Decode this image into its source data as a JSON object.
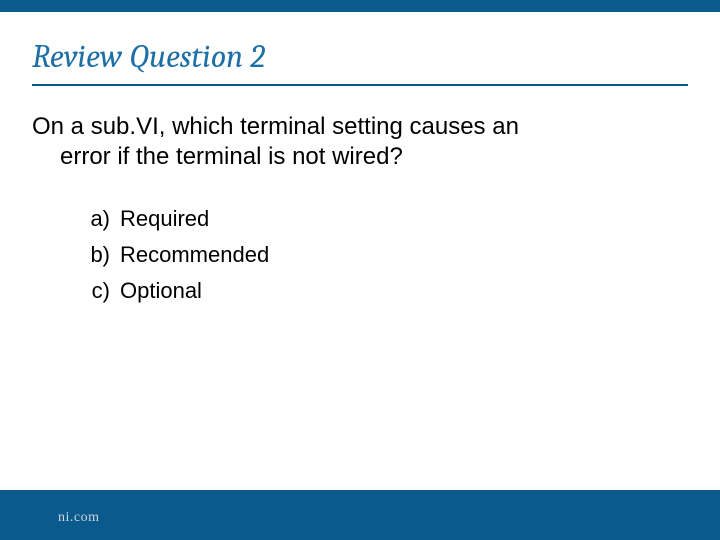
{
  "slide": {
    "title": "Review Question 2",
    "question_line1": "On a sub.VI, which terminal setting causes an",
    "question_line2": "error if the terminal is not wired?",
    "options": [
      {
        "letter": "a)",
        "text": "Required"
      },
      {
        "letter": "b)",
        "text": "Recommended"
      },
      {
        "letter": "c)",
        "text": "Optional"
      }
    ],
    "footer": "ni.com"
  }
}
